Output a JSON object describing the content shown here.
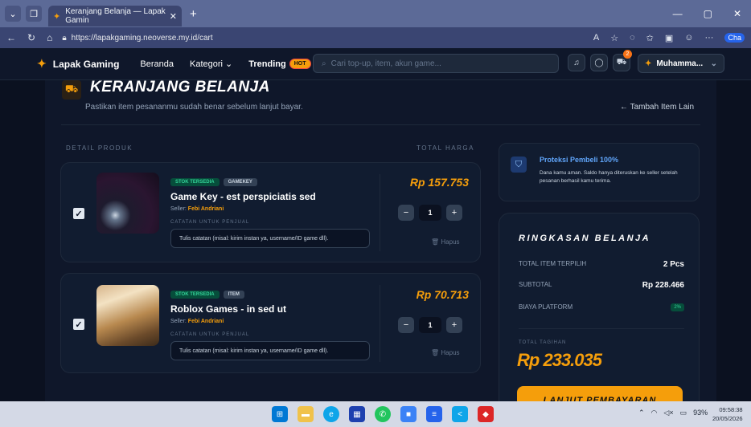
{
  "browser": {
    "tab_title": "Keranjang Belanja — Lapak Gamin",
    "tab_close": "✕",
    "new_tab": "+",
    "url": "https://lapakgaming.neoverse.my.id/cart",
    "chat_label": "Cha",
    "window_controls": [
      "—",
      "▢",
      "✕"
    ]
  },
  "navbar": {
    "brand": "Lapak Gaming",
    "links": [
      "Beranda",
      "Kategori ⌄",
      "Trending"
    ],
    "hot_badge": "HOT",
    "search_placeholder": "Cari top-up, item, akun game...",
    "cart_count": "2",
    "user_name": "Muhamma...",
    "user_chevron": "⌄"
  },
  "page": {
    "title": "KERANJANG BELANJA",
    "subtitle": "Pastikan item pesananmu sudah benar sebelum lanjut bayar.",
    "add_more": "← Tambah Item Lain",
    "col_product": "DETAIL PRODUK",
    "col_total": "TOTAL HARGA"
  },
  "items": [
    {
      "stock": "STOK TERSEDIA",
      "category": "GAMEKEY",
      "name": "Game Key - est perspiciatis sed",
      "seller_label": "Seller:",
      "seller": "Febi Andriani",
      "note_label": "CATATAN UNTUK PENJUAL",
      "note_placeholder": "Tulis catatan (misal: kirim instan ya, username/ID game dll).",
      "price": "Rp 157.753",
      "qty": "1",
      "remove": "Hapus",
      "checked": "✓"
    },
    {
      "stock": "STOK TERSEDIA",
      "category": "ITEM",
      "name": "Roblox Games - in sed ut",
      "seller_label": "Seller:",
      "seller": "Febi Andriani",
      "note_label": "CATATAN UNTUK PENJUAL",
      "note_placeholder": "Tulis catatan (misal: kirim instan ya, username/ID game dll).",
      "price": "Rp 70.713",
      "qty": "1",
      "remove": "Hapus",
      "checked": "✓"
    }
  ],
  "protection": {
    "title": "Proteksi Pembeli 100%",
    "desc": "Dana kamu aman. Saldo hanya diteruskan ke seller setelah pesanan berhasil kamu terima."
  },
  "summary": {
    "heading": "RINGKASAN BELANJA",
    "total_items_label": "TOTAL ITEM TERPILIH",
    "total_items": "2 Pcs",
    "subtotal_label": "SUBTOTAL",
    "subtotal": "Rp 228.466",
    "fee_label": "BIAYA PLATFORM",
    "fee": "2%",
    "bill_label": "TOTAL TAGIHAN",
    "bill": "Rp 233.035",
    "pay_button": "LANJUT PEMBAYARAN"
  },
  "taskbar": {
    "battery": "93%",
    "time": "09:58:38",
    "date": "20/05/2026"
  }
}
